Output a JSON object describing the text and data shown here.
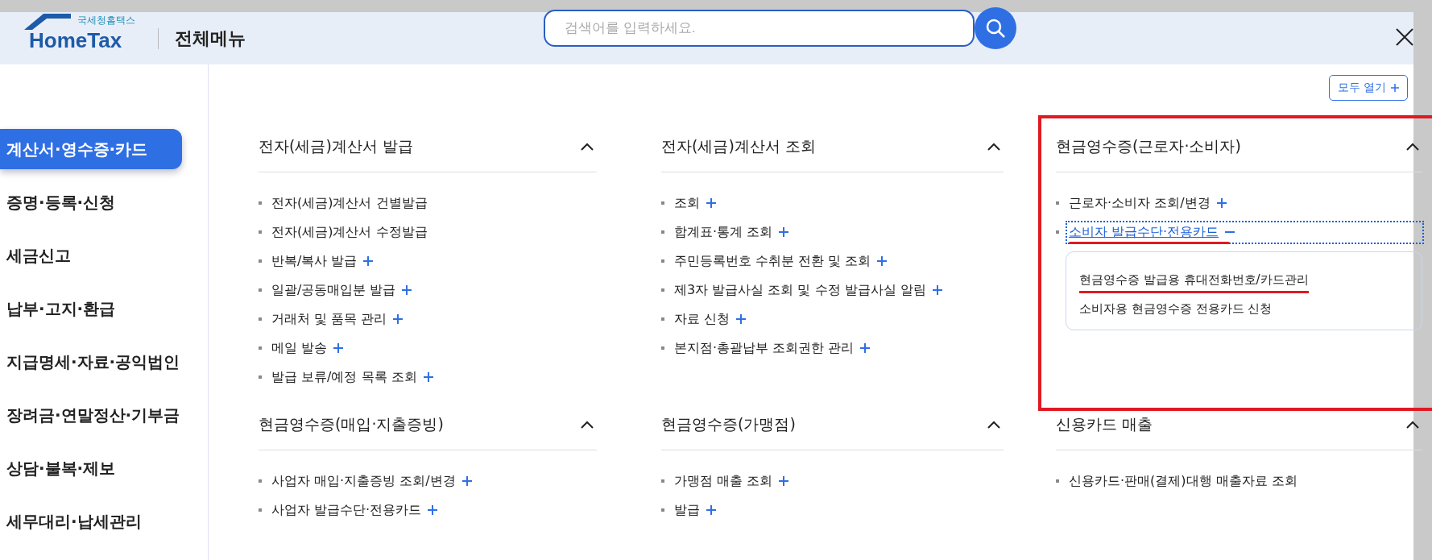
{
  "header": {
    "logo_caption": "국세청홈택스",
    "logo_text": "HomeTax",
    "title": "전체메뉴",
    "search": {
      "placeholder": "검색어를 입력하세요."
    }
  },
  "sidebar": {
    "items": [
      {
        "label": "계산서·영수증·카드",
        "selected": true
      },
      {
        "label": "증명·등록·신청",
        "selected": false
      },
      {
        "label": "세금신고",
        "selected": false
      },
      {
        "label": "납부·고지·환급",
        "selected": false
      },
      {
        "label": "지급명세·자료·공익법인",
        "selected": false
      },
      {
        "label": "장려금·연말정산·기부금",
        "selected": false
      },
      {
        "label": "상담·불복·제보",
        "selected": false
      },
      {
        "label": "세무대리·납세관리",
        "selected": false
      }
    ]
  },
  "open_all_button": {
    "label": "모두 열기"
  },
  "sections": [
    {
      "title": "전자(세금)계산서 발급",
      "expanded": true,
      "highlighted": false,
      "items": [
        {
          "label": "전자(세금)계산서 건별발급",
          "expandable": false,
          "expanded": false,
          "highlighted": false
        },
        {
          "label": "전자(세금)계산서 수정발급",
          "expandable": false,
          "expanded": false,
          "highlighted": false
        },
        {
          "label": "반복/복사 발급",
          "expandable": true,
          "expanded": false,
          "highlighted": false
        },
        {
          "label": "일괄/공동매입분 발급",
          "expandable": true,
          "expanded": false,
          "highlighted": false
        },
        {
          "label": "거래처 및 품목 관리",
          "expandable": true,
          "expanded": false,
          "highlighted": false
        },
        {
          "label": "메일 발송",
          "expandable": true,
          "expanded": false,
          "highlighted": false
        },
        {
          "label": "발급 보류/예정 목록 조회",
          "expandable": true,
          "expanded": false,
          "highlighted": false
        }
      ]
    },
    {
      "title": "전자(세금)계산서 조회",
      "expanded": true,
      "highlighted": false,
      "items": [
        {
          "label": "조회",
          "expandable": true,
          "expanded": false,
          "highlighted": false
        },
        {
          "label": "합계표·통계 조회",
          "expandable": true,
          "expanded": false,
          "highlighted": false
        },
        {
          "label": "주민등록번호 수취분 전환 및 조회",
          "expandable": true,
          "expanded": false,
          "highlighted": false
        },
        {
          "label": "제3자 발급사실 조회 및 수정 발급사실 알림",
          "expandable": true,
          "expanded": false,
          "highlighted": false
        },
        {
          "label": "자료 신청",
          "expandable": true,
          "expanded": false,
          "highlighted": false
        },
        {
          "label": "본지점·총괄납부 조회권한 관리",
          "expandable": true,
          "expanded": false,
          "highlighted": false
        }
      ]
    },
    {
      "title": "현금영수증(근로자·소비자)",
      "expanded": true,
      "highlighted": true,
      "items": [
        {
          "label": "근로자·소비자 조회/변경",
          "expandable": true,
          "expanded": false,
          "highlighted": false
        },
        {
          "label": "소비자 발급수단·전용카드",
          "expandable": true,
          "expanded": true,
          "highlighted": true,
          "children": [
            {
              "label": "현금영수증 발급용 휴대전화번호/카드관리",
              "highlighted": true
            },
            {
              "label": "소비자용 현금영수증 전용카드 신청",
              "highlighted": false
            }
          ]
        }
      ]
    },
    {
      "title": "현금영수증(매입·지출증빙)",
      "expanded": true,
      "highlighted": false,
      "items": [
        {
          "label": "사업자 매입·지출증빙 조회/변경",
          "expandable": true,
          "expanded": false,
          "highlighted": false
        },
        {
          "label": "사업자 발급수단·전용카드",
          "expandable": true,
          "expanded": false,
          "highlighted": false
        }
      ]
    },
    {
      "title": "현금영수증(가맹점)",
      "expanded": true,
      "highlighted": false,
      "items": [
        {
          "label": "가맹점 매출 조회",
          "expandable": true,
          "expanded": false,
          "highlighted": false
        },
        {
          "label": "발급",
          "expandable": true,
          "expanded": false,
          "highlighted": false
        }
      ]
    },
    {
      "title": "신용카드 매출",
      "expanded": true,
      "highlighted": false,
      "items": [
        {
          "label": "신용카드·판매(결제)대행 매출자료 조회",
          "expandable": false,
          "expanded": false,
          "highlighted": false
        }
      ]
    }
  ]
}
